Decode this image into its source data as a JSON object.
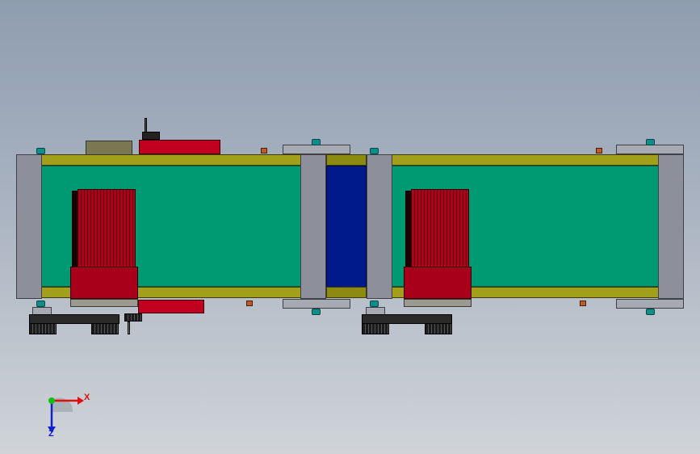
{
  "triad": {
    "x_label": "X",
    "z_label": "Z",
    "x_color": "#e01010",
    "y_color": "#10c010",
    "z_color": "#1020d0"
  },
  "colors": {
    "belt": "#009a72",
    "rail": "#8c8a10",
    "motor": "#b0001b",
    "frame": "#8d909b",
    "transfer_zone": "#001a8c"
  }
}
